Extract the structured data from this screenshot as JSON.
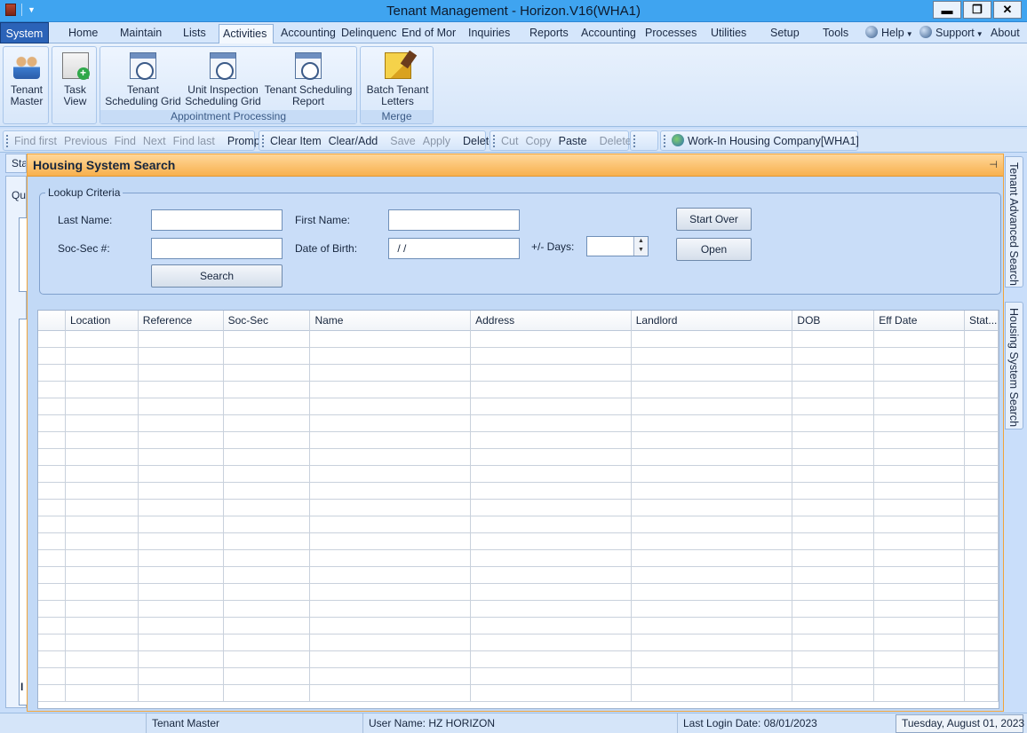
{
  "window": {
    "title": "Tenant Management - Horizon.V16(WHA1)",
    "minimize": "▬",
    "restore": "❐",
    "close": "✕"
  },
  "menu": {
    "items": [
      "System",
      "Home",
      "Maintain",
      "Lists",
      "Activities",
      "Accounting",
      "Delinquenc",
      "End of Mor",
      "Inquiries",
      "Reports",
      "Accounting",
      "Processes",
      "Utilities",
      "Setup",
      "Tools",
      "Help",
      "Support",
      "About"
    ],
    "active": "Activities"
  },
  "ribbon": {
    "buttons": {
      "tenant_master": [
        "Tenant",
        "Master"
      ],
      "task_view": [
        "Task",
        "View"
      ],
      "tenant_sched_grid": [
        "Tenant",
        "Scheduling Grid"
      ],
      "unit_insp_grid": [
        "Unit Inspection",
        "Scheduling Grid"
      ],
      "tenant_sched_report": [
        "Tenant Scheduling",
        "Report"
      ],
      "batch_letters": [
        "Batch Tenant",
        "Letters"
      ]
    },
    "groups": {
      "appointment": "Appointment Processing",
      "merge": "Merge"
    }
  },
  "toolbar": {
    "nav": [
      "Find first",
      "Previous",
      "Find",
      "Next",
      "Find last"
    ],
    "prompt": "Prompt",
    "edit": [
      "Clear Item",
      "Clear/Add"
    ],
    "edit_disabled": [
      "Save",
      "Apply"
    ],
    "delete": "Delete",
    "clip": [
      "Cut",
      "Copy"
    ],
    "paste": "Paste",
    "clip_delete": "Delete",
    "company": "Work-In Housing Company[WHA1]"
  },
  "left_strip": {
    "tab": "Sta",
    "q": "Qu",
    "bottom": "I"
  },
  "right_tabs": {
    "advanced": "Tenant Advanced Search",
    "housing": "Housing System Search"
  },
  "panel": {
    "title": "Housing System Search",
    "pin": "⊣"
  },
  "lookup": {
    "legend": "Lookup Criteria",
    "last_name_label": "Last Name:",
    "last_name_value": "",
    "first_name_label": "First Name:",
    "first_name_value": "",
    "ssn_label": "Soc-Sec #:",
    "ssn_value": "",
    "dob_label": "Date of Birth:",
    "dob_value": " / /",
    "days_label": "+/- Days:",
    "days_value": "",
    "search": "Search",
    "start_over": "Start Over",
    "open": "Open"
  },
  "grid": {
    "columns": [
      "Location",
      "Reference",
      "Soc-Sec",
      "Name",
      "Address",
      "Landlord",
      "DOB",
      "Eff Date",
      "Stat..."
    ],
    "rows": []
  },
  "status": {
    "module": "Tenant Master",
    "user": "User Name: HZ  HORIZON",
    "last_login": "Last Login Date: 08/01/2023",
    "date": "Tuesday, August 01, 2023"
  }
}
